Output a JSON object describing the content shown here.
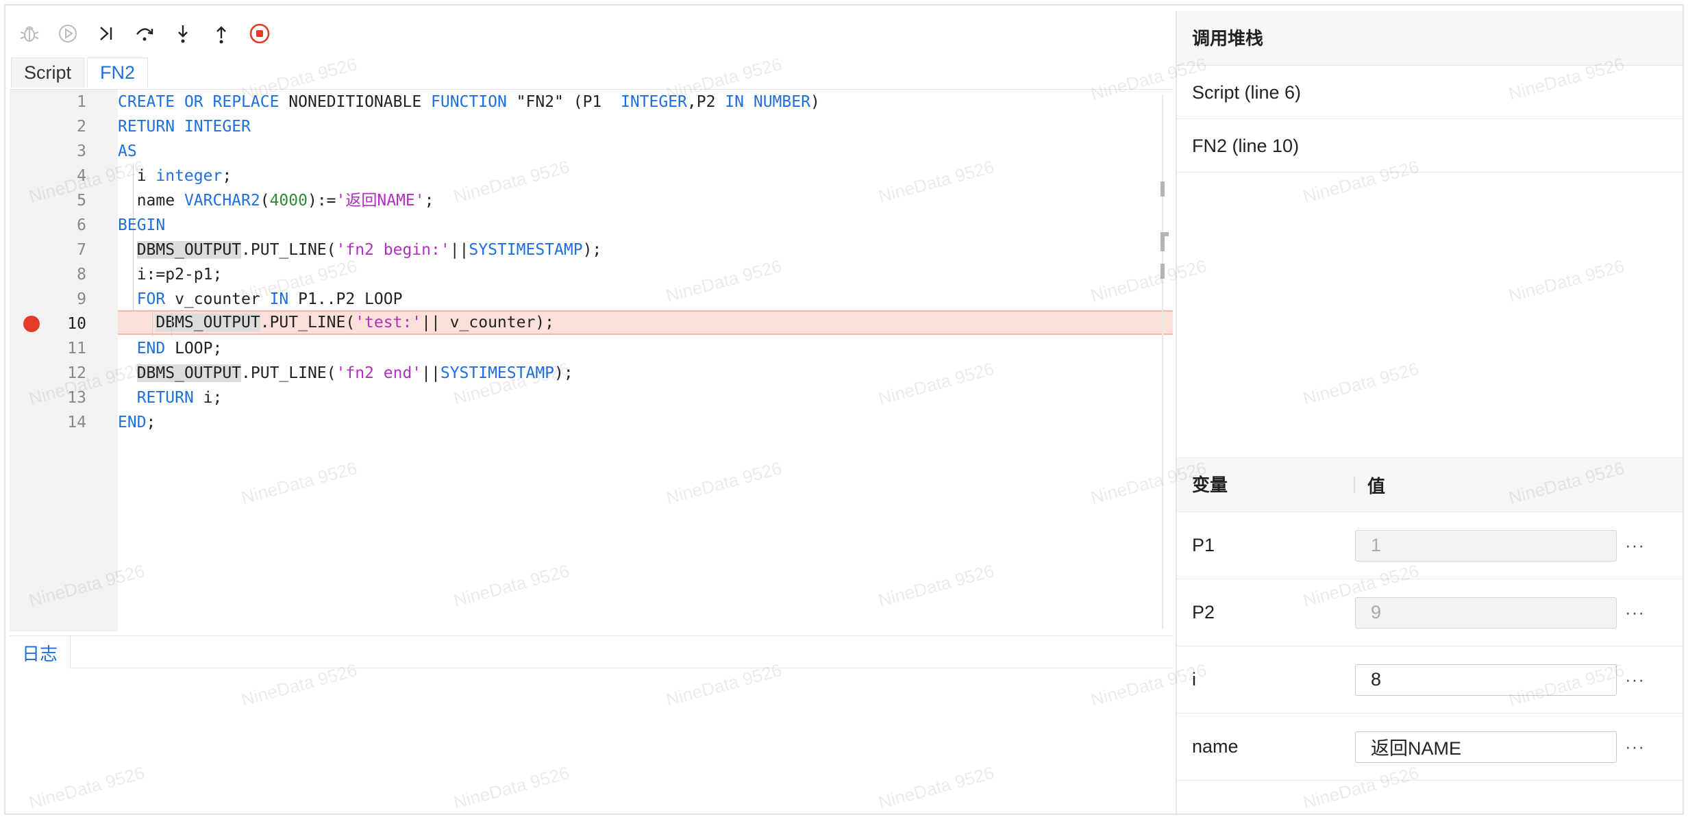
{
  "toolbar": {
    "buttons": [
      {
        "name": "debug-icon",
        "enabled": false
      },
      {
        "name": "continue-icon",
        "enabled": false
      },
      {
        "name": "run-to-end-icon",
        "enabled": true
      },
      {
        "name": "step-over-icon",
        "enabled": true
      },
      {
        "name": "step-into-icon",
        "enabled": true
      },
      {
        "name": "step-out-icon",
        "enabled": true
      },
      {
        "name": "stop-icon",
        "enabled": true
      }
    ]
  },
  "tabs": [
    {
      "label": "Script",
      "active": false
    },
    {
      "label": "FN2",
      "active": true
    }
  ],
  "editor": {
    "current_line": 10,
    "breakpoint_line": 10,
    "line_numbers": [
      "1",
      "2",
      "3",
      "4",
      "5",
      "6",
      "7",
      "8",
      "9",
      "10",
      "11",
      "12",
      "13",
      "14"
    ]
  },
  "log_tab": {
    "label": "日志"
  },
  "call_stack": {
    "title": "调用堆栈",
    "frames": [
      "Script (line 6)",
      "FN2 (line 10)"
    ]
  },
  "variables": {
    "header_name": "变量",
    "header_value": "值",
    "more_label": "···",
    "rows": [
      {
        "name": "P1",
        "value": "1",
        "editable": false
      },
      {
        "name": "P2",
        "value": "9",
        "editable": false
      },
      {
        "name": "i",
        "value": "8",
        "editable": true
      },
      {
        "name": "name",
        "value": "返回NAME",
        "editable": true
      }
    ]
  },
  "watermark": "NineData 9526",
  "colors": {
    "accent": "#1e6fe0",
    "breakpoint": "#e5392a",
    "current_line_bg": "#fbe0da",
    "stop": "#e5392a"
  }
}
